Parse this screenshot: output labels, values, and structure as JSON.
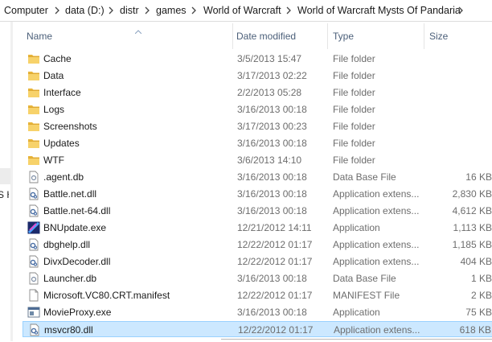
{
  "breadcrumb": {
    "items": [
      "Computer",
      "data (D:)",
      "distr",
      "games",
      "World of Warcraft",
      "World of Warcraft Mysts Of Pandaria"
    ]
  },
  "nav": {
    "fragment": "S H"
  },
  "columns": {
    "name": "Name",
    "date": "Date modified",
    "type": "Type",
    "size": "Size"
  },
  "files": [
    {
      "name": "Cache",
      "date": "3/5/2013 15:47",
      "type": "File folder",
      "size": "",
      "icon": "folder-icon"
    },
    {
      "name": "Data",
      "date": "3/17/2013 02:22",
      "type": "File folder",
      "size": "",
      "icon": "folder-icon"
    },
    {
      "name": "Interface",
      "date": "2/2/2013 05:28",
      "type": "File folder",
      "size": "",
      "icon": "folder-icon"
    },
    {
      "name": "Logs",
      "date": "3/16/2013 00:18",
      "type": "File folder",
      "size": "",
      "icon": "folder-icon"
    },
    {
      "name": "Screenshots",
      "date": "3/17/2013 00:23",
      "type": "File folder",
      "size": "",
      "icon": "folder-icon"
    },
    {
      "name": "Updates",
      "date": "3/16/2013 00:18",
      "type": "File folder",
      "size": "",
      "icon": "folder-icon"
    },
    {
      "name": "WTF",
      "date": "3/6/2013 14:10",
      "type": "File folder",
      "size": "",
      "icon": "folder-icon"
    },
    {
      "name": ".agent.db",
      "date": "3/16/2013 00:18",
      "type": "Data Base File",
      "size": "16 KB",
      "icon": "file-icon"
    },
    {
      "name": "Battle.net.dll",
      "date": "3/16/2013 00:18",
      "type": "Application extens...",
      "size": "2,830 KB",
      "icon": "dll-icon"
    },
    {
      "name": "Battle.net-64.dll",
      "date": "3/16/2013 00:18",
      "type": "Application extens...",
      "size": "4,612 KB",
      "icon": "dll-icon"
    },
    {
      "name": "BNUpdate.exe",
      "date": "12/21/2012 14:11",
      "type": "Application",
      "size": "1,113 KB",
      "icon": "bnupdate-icon"
    },
    {
      "name": "dbghelp.dll",
      "date": "12/22/2012 01:17",
      "type": "Application extens...",
      "size": "1,185 KB",
      "icon": "dll-icon"
    },
    {
      "name": "DivxDecoder.dll",
      "date": "12/22/2012 01:17",
      "type": "Application extens...",
      "size": "404 KB",
      "icon": "dll-icon"
    },
    {
      "name": "Launcher.db",
      "date": "3/16/2013 00:18",
      "type": "Data Base File",
      "size": "1 KB",
      "icon": "file-icon"
    },
    {
      "name": "Microsoft.VC80.CRT.manifest",
      "date": "12/22/2012 01:17",
      "type": "MANIFEST File",
      "size": "2 KB",
      "icon": "blank-file-icon"
    },
    {
      "name": "MovieProxy.exe",
      "date": "3/16/2013 00:18",
      "type": "Application",
      "size": "75 KB",
      "icon": "exe-icon"
    },
    {
      "name": "msvcr80.dll",
      "date": "12/22/2012 01:17",
      "type": "Application extens...",
      "size": "618 KB",
      "icon": "dll-icon",
      "selected": true
    }
  ],
  "colors": {
    "selected_bg": "#cce8ff",
    "selected_border": "#99d1ff",
    "header_text": "#4c607a",
    "folder": "#f4c74b"
  }
}
